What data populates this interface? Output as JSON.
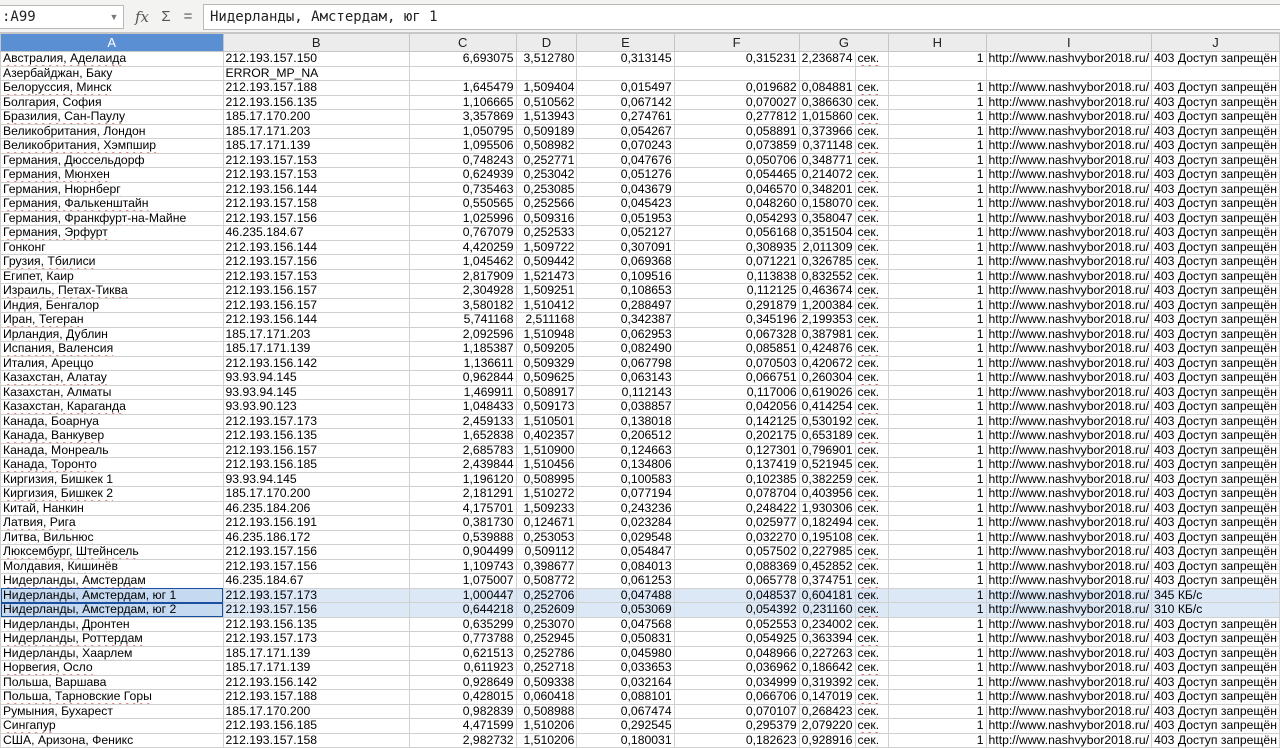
{
  "formula_bar": {
    "name_box": ":A99",
    "formula": "Нидерланды, Амстердам, юг 1",
    "icons": [
      "dropdown-arrow-icon",
      "function-wizard-icon",
      "sum-icon",
      "equals-icon"
    ]
  },
  "columns": [
    "A",
    "B",
    "C",
    "D",
    "E",
    "F",
    "G",
    "H",
    "I",
    "J"
  ],
  "active_column": "A",
  "selection_color": "#c5d9f1",
  "rows": [
    [
      "Австралия, Аделаида",
      "212.193.157.150",
      "6,693075",
      "3,512780",
      "0,313145",
      "0,315231",
      "2,236874",
      "сек.",
      "1",
      "http://www.nashvybor2018.ru/",
      "403 Доступ запрещён"
    ],
    [
      "Азербайджан, Баку",
      "ERROR_MP_NA",
      "",
      "",
      "",
      "",
      "",
      "",
      "",
      "",
      ""
    ],
    [
      "Белоруссия, Минск",
      "212.193.157.188",
      "1,645479",
      "1,509404",
      "0,015497",
      "0,019682",
      "0,084881",
      "сек.",
      "1",
      "http://www.nashvybor2018.ru/",
      "403 Доступ запрещён"
    ],
    [
      "Болгария, София",
      "212.193.156.135",
      "1,106665",
      "0,510562",
      "0,067142",
      "0,070027",
      "0,386630",
      "сек.",
      "1",
      "http://www.nashvybor2018.ru/",
      "403 Доступ запрещён"
    ],
    [
      "Бразилия, Сан-Паулу",
      "185.17.170.200",
      "3,357869",
      "1,513943",
      "0,274761",
      "0,277812",
      "1,015860",
      "сек.",
      "1",
      "http://www.nashvybor2018.ru/",
      "403 Доступ запрещён"
    ],
    [
      "Великобритания, Лондон",
      "185.17.171.203",
      "1,050795",
      "0,509189",
      "0,054267",
      "0,058891",
      "0,373966",
      "сек.",
      "1",
      "http://www.nashvybor2018.ru/",
      "403 Доступ запрещён"
    ],
    [
      "Великобритания, Хэмпшир",
      "185.17.171.139",
      "1,095506",
      "0,508982",
      "0,070243",
      "0,073859",
      "0,371148",
      "сек.",
      "1",
      "http://www.nashvybor2018.ru/",
      "403 Доступ запрещён"
    ],
    [
      "Германия, Дюссельдорф",
      "212.193.157.153",
      "0,748243",
      "0,252771",
      "0,047676",
      "0,050706",
      "0,348771",
      "сек.",
      "1",
      "http://www.nashvybor2018.ru/",
      "403 Доступ запрещён"
    ],
    [
      "Германия, Мюнхен",
      "212.193.157.153",
      "0,624939",
      "0,253042",
      "0,051276",
      "0,054465",
      "0,214072",
      "сек.",
      "1",
      "http://www.nashvybor2018.ru/",
      "403 Доступ запрещён"
    ],
    [
      "Германия, Нюрнберг",
      "212.193.156.144",
      "0,735463",
      "0,253085",
      "0,043679",
      "0,046570",
      "0,348201",
      "сек.",
      "1",
      "http://www.nashvybor2018.ru/",
      "403 Доступ запрещён"
    ],
    [
      "Германия, Фалькенштайн",
      "212.193.157.158",
      "0,550565",
      "0,252566",
      "0,045423",
      "0,048260",
      "0,158070",
      "сек.",
      "1",
      "http://www.nashvybor2018.ru/",
      "403 Доступ запрещён"
    ],
    [
      "Германия, Франкфурт-на-Майне",
      "212.193.157.156",
      "1,025996",
      "0,509316",
      "0,051953",
      "0,054293",
      "0,358047",
      "сек.",
      "1",
      "http://www.nashvybor2018.ru/",
      "403 Доступ запрещён"
    ],
    [
      "Германия, Эрфурт",
      "46.235.184.67",
      "0,767079",
      "0,252533",
      "0,052127",
      "0,056168",
      "0,351504",
      "сек.",
      "1",
      "http://www.nashvybor2018.ru/",
      "403 Доступ запрещён"
    ],
    [
      "Гонконг",
      "212.193.156.144",
      "4,420259",
      "1,509722",
      "0,307091",
      "0,308935",
      "2,011309",
      "сек.",
      "1",
      "http://www.nashvybor2018.ru/",
      "403 Доступ запрещён"
    ],
    [
      "Грузия, Тбилиси",
      "212.193.157.156",
      "1,045462",
      "0,509442",
      "0,069368",
      "0,071221",
      "0,326785",
      "сек.",
      "1",
      "http://www.nashvybor2018.ru/",
      "403 Доступ запрещён"
    ],
    [
      "Египет, Каир",
      "212.193.157.153",
      "2,817909",
      "1,521473",
      "0,109516",
      "0,113838",
      "0,832552",
      "сек.",
      "1",
      "http://www.nashvybor2018.ru/",
      "403 Доступ запрещён"
    ],
    [
      "Израиль, Петах-Тиква",
      "212.193.156.157",
      "2,304928",
      "1,509251",
      "0,108653",
      "0,112125",
      "0,463674",
      "сек.",
      "1",
      "http://www.nashvybor2018.ru/",
      "403 Доступ запрещён"
    ],
    [
      "Индия, Бенгалор",
      "212.193.156.157",
      "3,580182",
      "1,510412",
      "0,288497",
      "0,291879",
      "1,200384",
      "сек.",
      "1",
      "http://www.nashvybor2018.ru/",
      "403 Доступ запрещён"
    ],
    [
      "Иран, Тегеран",
      "212.193.156.144",
      "5,741168",
      "2,511168",
      "0,342387",
      "0,345196",
      "2,199353",
      "сек.",
      "1",
      "http://www.nashvybor2018.ru/",
      "403 Доступ запрещён"
    ],
    [
      "Ирландия, Дублин",
      "185.17.171.203",
      "2,092596",
      "1,510948",
      "0,062953",
      "0,067328",
      "0,387981",
      "сек.",
      "1",
      "http://www.nashvybor2018.ru/",
      "403 Доступ запрещён"
    ],
    [
      "Испания, Валенсия",
      "185.17.171.139",
      "1,185387",
      "0,509205",
      "0,082490",
      "0,085851",
      "0,424876",
      "сек.",
      "1",
      "http://www.nashvybor2018.ru/",
      "403 Доступ запрещён"
    ],
    [
      "Италия, Ареццо",
      "212.193.156.142",
      "1,136611",
      "0,509329",
      "0,067798",
      "0,070503",
      "0,420672",
      "сек.",
      "1",
      "http://www.nashvybor2018.ru/",
      "403 Доступ запрещён"
    ],
    [
      "Казахстан, Алатау",
      "93.93.94.145",
      "0,962844",
      "0,509625",
      "0,063143",
      "0,066751",
      "0,260304",
      "сек.",
      "1",
      "http://www.nashvybor2018.ru/",
      "403 Доступ запрещён"
    ],
    [
      "Казахстан, Алматы",
      "93.93.94.145",
      "1,469911",
      "0,508917",
      "0,112143",
      "0,117006",
      "0,619026",
      "сек.",
      "1",
      "http://www.nashvybor2018.ru/",
      "403 Доступ запрещён"
    ],
    [
      "Казахстан, Караганда",
      "93.93.90.123",
      "1,048433",
      "0,509173",
      "0,038857",
      "0,042056",
      "0,414254",
      "сек.",
      "1",
      "http://www.nashvybor2018.ru/",
      "403 Доступ запрещён"
    ],
    [
      "Канада, Боарнуа",
      "212.193.157.173",
      "2,459133",
      "1,510501",
      "0,138018",
      "0,142125",
      "0,530192",
      "сек.",
      "1",
      "http://www.nashvybor2018.ru/",
      "403 Доступ запрещён"
    ],
    [
      "Канада, Ванкувер",
      "212.193.156.135",
      "1,652838",
      "0,402357",
      "0,206512",
      "0,202175",
      "0,653189",
      "сек.",
      "1",
      "http://www.nashvybor2018.ru/",
      "403 Доступ запрещён"
    ],
    [
      "Канада, Монреаль",
      "212.193.156.157",
      "2,685783",
      "1,510900",
      "0,124663",
      "0,127301",
      "0,796901",
      "сек.",
      "1",
      "http://www.nashvybor2018.ru/",
      "403 Доступ запрещён"
    ],
    [
      "Канада, Торонто",
      "212.193.156.185",
      "2,439844",
      "1,510456",
      "0,134806",
      "0,137419",
      "0,521945",
      "сек.",
      "1",
      "http://www.nashvybor2018.ru/",
      "403 Доступ запрещён"
    ],
    [
      "Киргизия, Бишкек 1",
      "93.93.94.145",
      "1,196120",
      "0,508995",
      "0,100583",
      "0,102385",
      "0,382259",
      "сек.",
      "1",
      "http://www.nashvybor2018.ru/",
      "403 Доступ запрещён"
    ],
    [
      "Киргизия, Бишкек 2",
      "185.17.170.200",
      "2,181291",
      "1,510272",
      "0,077194",
      "0,078704",
      "0,403956",
      "сек.",
      "1",
      "http://www.nashvybor2018.ru/",
      "403 Доступ запрещён"
    ],
    [
      "Китай, Нанкин",
      "46.235.184.206",
      "4,175701",
      "1,509233",
      "0,243236",
      "0,248422",
      "1,930306",
      "сек.",
      "1",
      "http://www.nashvybor2018.ru/",
      "403 Доступ запрещён"
    ],
    [
      "Латвия, Рига",
      "212.193.156.191",
      "0,381730",
      "0,124671",
      "0,023284",
      "0,025977",
      "0,182494",
      "сек.",
      "1",
      "http://www.nashvybor2018.ru/",
      "403 Доступ запрещён"
    ],
    [
      "Литва, Вильнюс",
      "46.235.186.172",
      "0,539888",
      "0,253053",
      "0,029548",
      "0,032270",
      "0,195108",
      "сек.",
      "1",
      "http://www.nashvybor2018.ru/",
      "403 Доступ запрещён"
    ],
    [
      "Люксембург, Штейнсель",
      "212.193.157.156",
      "0,904499",
      "0,509112",
      "0,054847",
      "0,057502",
      "0,227985",
      "сек.",
      "1",
      "http://www.nashvybor2018.ru/",
      "403 Доступ запрещён"
    ],
    [
      "Молдавия, Кишинёв",
      "212.193.157.156",
      "1,109743",
      "0,398677",
      "0,084013",
      "0,088369",
      "0,452852",
      "сек.",
      "1",
      "http://www.nashvybor2018.ru/",
      "403 Доступ запрещён"
    ],
    [
      "Нидерланды, Амстердам",
      "46.235.184.67",
      "1,075007",
      "0,508772",
      "0,061253",
      "0,065778",
      "0,374751",
      "сек.",
      "1",
      "http://www.nashvybor2018.ru/",
      "403 Доступ запрещён"
    ],
    [
      "Нидерланды, Амстердам, юг 1",
      "212.193.157.173",
      "1,000447",
      "0,252706",
      "0,047488",
      "0,048537",
      "0,604181",
      "сек.",
      "1",
      "http://www.nashvybor2018.ru/",
      "345 КБ/с"
    ],
    [
      "Нидерланды, Амстердам, юг 2",
      "212.193.157.156",
      "0,644218",
      "0,252609",
      "0,053069",
      "0,054392",
      "0,231160",
      "сек.",
      "1",
      "http://www.nashvybor2018.ru/",
      "310 КБ/с"
    ],
    [
      "Нидерланды, Дронтен",
      "212.193.156.135",
      "0,635299",
      "0,253070",
      "0,047568",
      "0,052553",
      "0,234002",
      "сек.",
      "1",
      "http://www.nashvybor2018.ru/",
      "403 Доступ запрещён"
    ],
    [
      "Нидерланды, Роттердам",
      "212.193.157.173",
      "0,773788",
      "0,252945",
      "0,050831",
      "0,054925",
      "0,363394",
      "сек.",
      "1",
      "http://www.nashvybor2018.ru/",
      "403 Доступ запрещён"
    ],
    [
      "Нидерланды, Хаарлем",
      "185.17.171.139",
      "0,621513",
      "0,252786",
      "0,045980",
      "0,048966",
      "0,227263",
      "сек.",
      "1",
      "http://www.nashvybor2018.ru/",
      "403 Доступ запрещён"
    ],
    [
      "Норвегия, Осло",
      "185.17.171.139",
      "0,611923",
      "0,252718",
      "0,033653",
      "0,036962",
      "0,186642",
      "сек.",
      "1",
      "http://www.nashvybor2018.ru/",
      "403 Доступ запрещён"
    ],
    [
      "Польша, Варшава",
      "212.193.156.142",
      "0,928649",
      "0,509338",
      "0,032164",
      "0,034999",
      "0,319392",
      "сек.",
      "1",
      "http://www.nashvybor2018.ru/",
      "403 Доступ запрещён"
    ],
    [
      "Польша, Тарновские Горы",
      "212.193.157.188",
      "0,428015",
      "0,060418",
      "0,088101",
      "0,066706",
      "0,147019",
      "сек.",
      "1",
      "http://www.nashvybor2018.ru/",
      "403 Доступ запрещён"
    ],
    [
      "Румыния, Бухарест",
      "185.17.170.200",
      "0,982839",
      "0,508988",
      "0,067474",
      "0,070107",
      "0,268423",
      "сек.",
      "1",
      "http://www.nashvybor2018.ru/",
      "403 Доступ запрещён"
    ],
    [
      "Сингапур",
      "212.193.156.185",
      "4,471599",
      "1,510206",
      "0,292545",
      "0,295379",
      "2,079220",
      "сек.",
      "1",
      "http://www.nashvybor2018.ru/",
      "403 Доступ запрещён"
    ],
    [
      "США, Аризона, Феникс",
      "212.193.157.158",
      "2,982732",
      "1,510206",
      "0,180031",
      "0,182623",
      "0,928916",
      "сек.",
      "1",
      "http://www.nashvybor2018.ru/",
      "403 Доступ запрещён"
    ]
  ],
  "selected_rows": [
    37,
    38
  ],
  "extra_column_values": {
    "37": "3",
    "38": "3"
  }
}
